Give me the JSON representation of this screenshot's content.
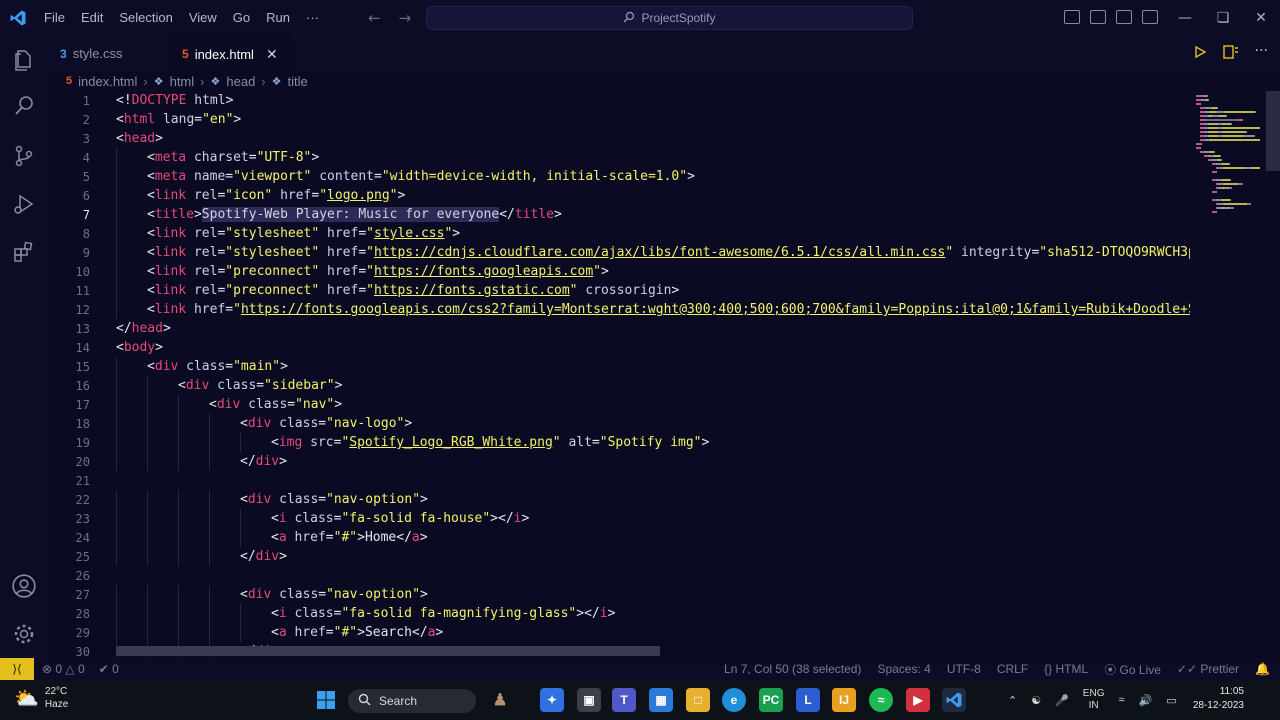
{
  "titlebar": {
    "menu": [
      "File",
      "Edit",
      "Selection",
      "View",
      "Go",
      "Run",
      "···"
    ],
    "search_label": "ProjectSpotify"
  },
  "tabs": [
    {
      "label": "style.css",
      "icon": "css-file-icon",
      "active": false
    },
    {
      "label": "index.html",
      "icon": "html-file-icon",
      "active": true
    }
  ],
  "breadcrumb": [
    "index.html",
    "html",
    "head",
    "title"
  ],
  "editor": {
    "current_line": 7,
    "lines": [
      {
        "n": 1,
        "indent": 0,
        "segs": [
          [
            "punct",
            "<!"
          ],
          [
            "tag",
            "DOCTYPE"
          ],
          [
            "punct",
            " "
          ],
          [
            "attr",
            "html"
          ],
          [
            "punct",
            ">"
          ]
        ]
      },
      {
        "n": 2,
        "indent": 0,
        "segs": [
          [
            "punct",
            "<"
          ],
          [
            "tag",
            "html"
          ],
          [
            "punct",
            " "
          ],
          [
            "attr",
            "lang"
          ],
          [
            "punct",
            "="
          ],
          [
            "str",
            "\"en\""
          ],
          [
            "punct",
            ">"
          ]
        ]
      },
      {
        "n": 3,
        "indent": 0,
        "segs": [
          [
            "punct",
            "<"
          ],
          [
            "tag",
            "head"
          ],
          [
            "punct",
            ">"
          ]
        ]
      },
      {
        "n": 4,
        "indent": 1,
        "segs": [
          [
            "punct",
            "<"
          ],
          [
            "tag",
            "meta"
          ],
          [
            "punct",
            " "
          ],
          [
            "attr",
            "charset"
          ],
          [
            "punct",
            "="
          ],
          [
            "str",
            "\"UTF-8\""
          ],
          [
            "punct",
            ">"
          ]
        ]
      },
      {
        "n": 5,
        "indent": 1,
        "segs": [
          [
            "punct",
            "<"
          ],
          [
            "tag",
            "meta"
          ],
          [
            "punct",
            " "
          ],
          [
            "attr",
            "name"
          ],
          [
            "punct",
            "="
          ],
          [
            "str",
            "\"viewport\""
          ],
          [
            "punct",
            " "
          ],
          [
            "attr",
            "content"
          ],
          [
            "punct",
            "="
          ],
          [
            "str",
            "\"width=device-width, initial-scale=1.0\""
          ],
          [
            "punct",
            ">"
          ]
        ]
      },
      {
        "n": 6,
        "indent": 1,
        "segs": [
          [
            "punct",
            "<"
          ],
          [
            "tag",
            "link"
          ],
          [
            "punct",
            " "
          ],
          [
            "attr",
            "rel"
          ],
          [
            "punct",
            "="
          ],
          [
            "str",
            "\"icon\""
          ],
          [
            "punct",
            " "
          ],
          [
            "attr",
            "href"
          ],
          [
            "punct",
            "="
          ],
          [
            "str",
            "\""
          ],
          [
            "lnk",
            "logo.png"
          ],
          [
            "str",
            "\""
          ],
          [
            "punct",
            ">"
          ]
        ]
      },
      {
        "n": 7,
        "indent": 1,
        "segs": [
          [
            "punct",
            "<"
          ],
          [
            "tag",
            "title"
          ],
          [
            "punct",
            ">"
          ],
          [
            "sel",
            "Spotify-Web Player: Music for everyone"
          ],
          [
            "punct",
            "</"
          ],
          [
            "tag",
            "title"
          ],
          [
            "punct",
            ">"
          ]
        ]
      },
      {
        "n": 8,
        "indent": 1,
        "segs": [
          [
            "punct",
            "<"
          ],
          [
            "tag",
            "link"
          ],
          [
            "punct",
            " "
          ],
          [
            "attr",
            "rel"
          ],
          [
            "punct",
            "="
          ],
          [
            "str",
            "\"stylesheet\""
          ],
          [
            "punct",
            " "
          ],
          [
            "attr",
            "href"
          ],
          [
            "punct",
            "="
          ],
          [
            "str",
            "\""
          ],
          [
            "lnk",
            "style.css"
          ],
          [
            "str",
            "\""
          ],
          [
            "punct",
            ">"
          ]
        ]
      },
      {
        "n": 9,
        "indent": 1,
        "segs": [
          [
            "punct",
            "<"
          ],
          [
            "tag",
            "link"
          ],
          [
            "punct",
            " "
          ],
          [
            "attr",
            "rel"
          ],
          [
            "punct",
            "="
          ],
          [
            "str",
            "\"stylesheet\""
          ],
          [
            "punct",
            " "
          ],
          [
            "attr",
            "href"
          ],
          [
            "punct",
            "="
          ],
          [
            "str",
            "\""
          ],
          [
            "lnk",
            "https://cdnjs.cloudflare.com/ajax/libs/font-awesome/6.5.1/css/all.min.css"
          ],
          [
            "str",
            "\""
          ],
          [
            "punct",
            " "
          ],
          [
            "attr",
            "integrity"
          ],
          [
            "punct",
            "="
          ],
          [
            "str",
            "\"sha512-DTOQO9RWCH3pp"
          ]
        ]
      },
      {
        "n": 10,
        "indent": 1,
        "segs": [
          [
            "punct",
            "<"
          ],
          [
            "tag",
            "link"
          ],
          [
            "punct",
            " "
          ],
          [
            "attr",
            "rel"
          ],
          [
            "punct",
            "="
          ],
          [
            "str",
            "\"preconnect\""
          ],
          [
            "punct",
            " "
          ],
          [
            "attr",
            "href"
          ],
          [
            "punct",
            "="
          ],
          [
            "str",
            "\""
          ],
          [
            "lnk",
            "https://fonts.googleapis.com"
          ],
          [
            "str",
            "\""
          ],
          [
            "punct",
            ">"
          ]
        ]
      },
      {
        "n": 11,
        "indent": 1,
        "segs": [
          [
            "punct",
            "<"
          ],
          [
            "tag",
            "link"
          ],
          [
            "punct",
            " "
          ],
          [
            "attr",
            "rel"
          ],
          [
            "punct",
            "="
          ],
          [
            "str",
            "\"preconnect\""
          ],
          [
            "punct",
            " "
          ],
          [
            "attr",
            "href"
          ],
          [
            "punct",
            "="
          ],
          [
            "str",
            "\""
          ],
          [
            "lnk",
            "https://fonts.gstatic.com"
          ],
          [
            "str",
            "\""
          ],
          [
            "punct",
            " "
          ],
          [
            "attr",
            "crossorigin"
          ],
          [
            "punct",
            ">"
          ]
        ]
      },
      {
        "n": 12,
        "indent": 1,
        "segs": [
          [
            "punct",
            "<"
          ],
          [
            "tag",
            "link"
          ],
          [
            "punct",
            " "
          ],
          [
            "attr",
            "href"
          ],
          [
            "punct",
            "="
          ],
          [
            "str",
            "\""
          ],
          [
            "lnk",
            "https://fonts.googleapis.com/css2?family=Montserrat:wght@300;400;500;600;700&family=Poppins:ital@0;1&family=Rubik+Doodle+Sh"
          ]
        ]
      },
      {
        "n": 13,
        "indent": 0,
        "segs": [
          [
            "punct",
            "</"
          ],
          [
            "tag",
            "head"
          ],
          [
            "punct",
            ">"
          ]
        ]
      },
      {
        "n": 14,
        "indent": 0,
        "segs": [
          [
            "punct",
            "<"
          ],
          [
            "tag",
            "body"
          ],
          [
            "punct",
            ">"
          ]
        ]
      },
      {
        "n": 15,
        "indent": 1,
        "segs": [
          [
            "punct",
            "<"
          ],
          [
            "tag",
            "div"
          ],
          [
            "punct",
            " "
          ],
          [
            "attr",
            "class"
          ],
          [
            "punct",
            "="
          ],
          [
            "str",
            "\"main\""
          ],
          [
            "punct",
            ">"
          ]
        ]
      },
      {
        "n": 16,
        "indent": 2,
        "segs": [
          [
            "punct",
            "<"
          ],
          [
            "tag",
            "div"
          ],
          [
            "punct",
            " "
          ],
          [
            "attr",
            "class"
          ],
          [
            "punct",
            "="
          ],
          [
            "str",
            "\"sidebar\""
          ],
          [
            "punct",
            ">"
          ]
        ]
      },
      {
        "n": 17,
        "indent": 3,
        "segs": [
          [
            "punct",
            "<"
          ],
          [
            "tag",
            "div"
          ],
          [
            "punct",
            " "
          ],
          [
            "attr",
            "class"
          ],
          [
            "punct",
            "="
          ],
          [
            "str",
            "\"nav\""
          ],
          [
            "punct",
            ">"
          ]
        ]
      },
      {
        "n": 18,
        "indent": 4,
        "segs": [
          [
            "punct",
            "<"
          ],
          [
            "tag",
            "div"
          ],
          [
            "punct",
            " "
          ],
          [
            "attr",
            "class"
          ],
          [
            "punct",
            "="
          ],
          [
            "str",
            "\"nav-logo\""
          ],
          [
            "punct",
            ">"
          ]
        ]
      },
      {
        "n": 19,
        "indent": 5,
        "segs": [
          [
            "punct",
            "<"
          ],
          [
            "tag",
            "img"
          ],
          [
            "punct",
            " "
          ],
          [
            "attr",
            "src"
          ],
          [
            "punct",
            "="
          ],
          [
            "str",
            "\""
          ],
          [
            "lnk",
            "Spotify_Logo_RGB_White.png"
          ],
          [
            "str",
            "\""
          ],
          [
            "punct",
            " "
          ],
          [
            "attr",
            "alt"
          ],
          [
            "punct",
            "="
          ],
          [
            "str",
            "\"Spotify img\""
          ],
          [
            "punct",
            ">"
          ]
        ]
      },
      {
        "n": 20,
        "indent": 4,
        "segs": [
          [
            "punct",
            "</"
          ],
          [
            "tag",
            "div"
          ],
          [
            "punct",
            ">"
          ]
        ]
      },
      {
        "n": 21,
        "indent": 0,
        "segs": []
      },
      {
        "n": 22,
        "indent": 4,
        "segs": [
          [
            "punct",
            "<"
          ],
          [
            "tag",
            "div"
          ],
          [
            "punct",
            " "
          ],
          [
            "attr",
            "class"
          ],
          [
            "punct",
            "="
          ],
          [
            "str",
            "\"nav-option\""
          ],
          [
            "punct",
            ">"
          ]
        ]
      },
      {
        "n": 23,
        "indent": 5,
        "segs": [
          [
            "punct",
            "<"
          ],
          [
            "tag",
            "i"
          ],
          [
            "punct",
            " "
          ],
          [
            "attr",
            "class"
          ],
          [
            "punct",
            "="
          ],
          [
            "str",
            "\"fa-solid fa-house\""
          ],
          [
            "punct",
            "></"
          ],
          [
            "tag",
            "i"
          ],
          [
            "punct",
            ">"
          ]
        ]
      },
      {
        "n": 24,
        "indent": 5,
        "segs": [
          [
            "punct",
            "<"
          ],
          [
            "tag",
            "a"
          ],
          [
            "punct",
            " "
          ],
          [
            "attr",
            "href"
          ],
          [
            "punct",
            "="
          ],
          [
            "str",
            "\"#\""
          ],
          [
            "punct",
            ">"
          ],
          [
            "txt",
            "Home"
          ],
          [
            "punct",
            "</"
          ],
          [
            "tag",
            "a"
          ],
          [
            "punct",
            ">"
          ]
        ]
      },
      {
        "n": 25,
        "indent": 4,
        "segs": [
          [
            "punct",
            "</"
          ],
          [
            "tag",
            "div"
          ],
          [
            "punct",
            ">"
          ]
        ]
      },
      {
        "n": 26,
        "indent": 0,
        "segs": []
      },
      {
        "n": 27,
        "indent": 4,
        "segs": [
          [
            "punct",
            "<"
          ],
          [
            "tag",
            "div"
          ],
          [
            "punct",
            " "
          ],
          [
            "attr",
            "class"
          ],
          [
            "punct",
            "="
          ],
          [
            "str",
            "\"nav-option\""
          ],
          [
            "punct",
            ">"
          ]
        ]
      },
      {
        "n": 28,
        "indent": 5,
        "segs": [
          [
            "punct",
            "<"
          ],
          [
            "tag",
            "i"
          ],
          [
            "punct",
            " "
          ],
          [
            "attr",
            "class"
          ],
          [
            "punct",
            "="
          ],
          [
            "str",
            "\"fa-solid fa-magnifying-glass\""
          ],
          [
            "punct",
            "></"
          ],
          [
            "tag",
            "i"
          ],
          [
            "punct",
            ">"
          ]
        ]
      },
      {
        "n": 29,
        "indent": 5,
        "segs": [
          [
            "punct",
            "<"
          ],
          [
            "tag",
            "a"
          ],
          [
            "punct",
            " "
          ],
          [
            "attr",
            "href"
          ],
          [
            "punct",
            "="
          ],
          [
            "str",
            "\"#\""
          ],
          [
            "punct",
            ">"
          ],
          [
            "txt",
            "Search"
          ],
          [
            "punct",
            "</"
          ],
          [
            "tag",
            "a"
          ],
          [
            "punct",
            ">"
          ]
        ]
      },
      {
        "n": 30,
        "indent": 4,
        "segs": [
          [
            "punct",
            "</"
          ],
          [
            "tag",
            "div"
          ],
          [
            "punct",
            ">"
          ]
        ]
      }
    ]
  },
  "statusbar": {
    "errors": "0",
    "warnings": "0",
    "ports": "0",
    "position": "Ln 7, Col 50 (38 selected)",
    "spaces": "Spaces: 4",
    "encoding": "UTF-8",
    "eol": "CRLF",
    "language": "HTML",
    "golive": "Go Live",
    "prettier": "Prettier"
  },
  "taskbar": {
    "weather_temp": "22°C",
    "weather_desc": "Haze",
    "search_label": "Search",
    "lang_top": "ENG",
    "lang_bottom": "IN",
    "time": "11:05",
    "date": "28-12-2023"
  },
  "colors": {
    "background": "#0a0a23",
    "tag": "#e44b7a",
    "string": "#f3f36a",
    "attribute": "#c8d0f0",
    "remote_indicator": "#e3c01c",
    "vscode_blue": "#3b9cf0"
  }
}
